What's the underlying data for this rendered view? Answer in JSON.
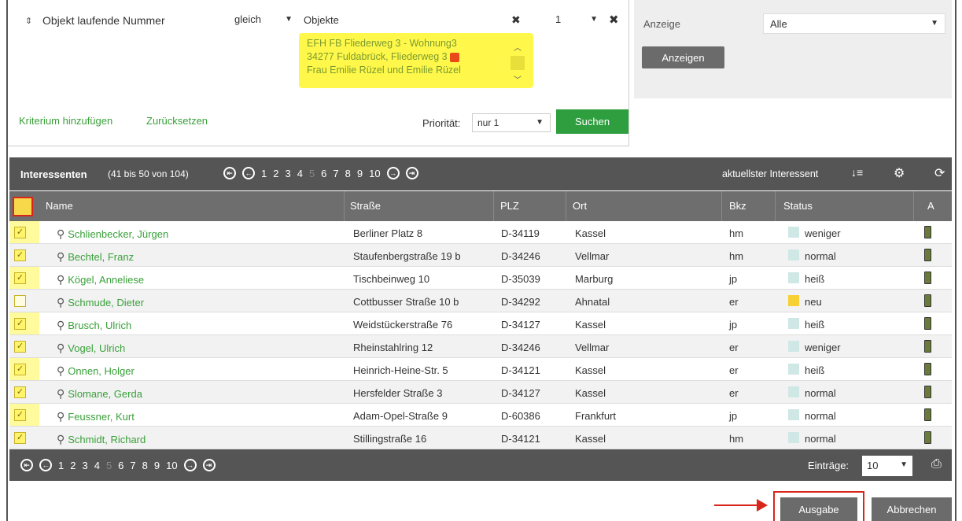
{
  "search": {
    "criterion_label": "Objekt laufende Nummer",
    "operator": "gleich",
    "objects_label": "Objekte",
    "object_lines": [
      "EFH FB Fliederweg 3 - Wohnung3",
      "34277 Fuldabrück, Fliederweg 3",
      "Frau Emilie Rüzel und Emilie Rüzel"
    ],
    "count_value": "1",
    "add_criterion": "Kriterium hinzufügen",
    "reset": "Zurücksetzen",
    "priority_label": "Priorität:",
    "priority_value": "nur 1",
    "search_button": "Suchen"
  },
  "display": {
    "label": "Anzeige",
    "value": "Alle",
    "button": "Anzeigen"
  },
  "results": {
    "title": "Interessenten",
    "range": "(41 bis 50 von 104)",
    "pages": [
      "1",
      "2",
      "3",
      "4",
      "5",
      "6",
      "7",
      "8",
      "9",
      "10"
    ],
    "current_page": "5",
    "latest_label": "aktuellster Interessent"
  },
  "columns": {
    "name": "Name",
    "street": "Straße",
    "zip": "PLZ",
    "city": "Ort",
    "bkz": "Bkz",
    "status": "Status",
    "a": "A"
  },
  "rows": [
    {
      "checked": true,
      "name": "Schlienbecker, Jürgen",
      "street": "Berliner Platz 8",
      "zip": "D-34119",
      "city": "Kassel",
      "bkz": "hm",
      "status": "weniger"
    },
    {
      "checked": true,
      "name": "Bechtel, Franz",
      "street": "Staufenbergstraße 19 b",
      "zip": "D-34246",
      "city": "Vellmar",
      "bkz": "hm",
      "status": "normal"
    },
    {
      "checked": true,
      "name": "Kögel, Anneliese",
      "street": "Tischbeinweg 10",
      "zip": "D-35039",
      "city": "Marburg",
      "bkz": "jp",
      "status": "heiß"
    },
    {
      "checked": false,
      "name": "Schmude, Dieter",
      "street": "Cottbusser Straße 10 b",
      "zip": "D-34292",
      "city": "Ahnatal",
      "bkz": "er",
      "status": "neu"
    },
    {
      "checked": true,
      "name": "Brusch, Ulrich",
      "street": "Weidstückerstraße 76",
      "zip": "D-34127",
      "city": "Kassel",
      "bkz": "jp",
      "status": "heiß"
    },
    {
      "checked": true,
      "name": "Vogel, Ulrich",
      "street": "Rheinstahlring 12",
      "zip": "D-34246",
      "city": "Vellmar",
      "bkz": "er",
      "status": "weniger"
    },
    {
      "checked": true,
      "name": "Onnen, Holger",
      "street": "Heinrich-Heine-Str. 5",
      "zip": "D-34121",
      "city": "Kassel",
      "bkz": "er",
      "status": "heiß"
    },
    {
      "checked": true,
      "name": "Slomane, Gerda",
      "street": "Hersfelder Straße 3",
      "zip": "D-34127",
      "city": "Kassel",
      "bkz": "er",
      "status": "normal"
    },
    {
      "checked": true,
      "name": "Feussner, Kurt",
      "street": "Adam-Opel-Straße 9",
      "zip": "D-60386",
      "city": "Frankfurt",
      "bkz": "jp",
      "status": "normal"
    },
    {
      "checked": true,
      "name": "Schmidt, Richard",
      "street": "Stillingstraße 16",
      "zip": "D-34121",
      "city": "Kassel",
      "bkz": "hm",
      "status": "normal"
    }
  ],
  "footer": {
    "entries_label": "Einträge:",
    "entries_value": "10"
  },
  "actions": {
    "output": "Ausgabe",
    "cancel": "Abbrechen"
  },
  "colors": {
    "accent_green": "#2e9e3e",
    "highlight_yellow": "#fff84a",
    "annotation_red": "#d8261a",
    "header_gray": "#555555"
  }
}
